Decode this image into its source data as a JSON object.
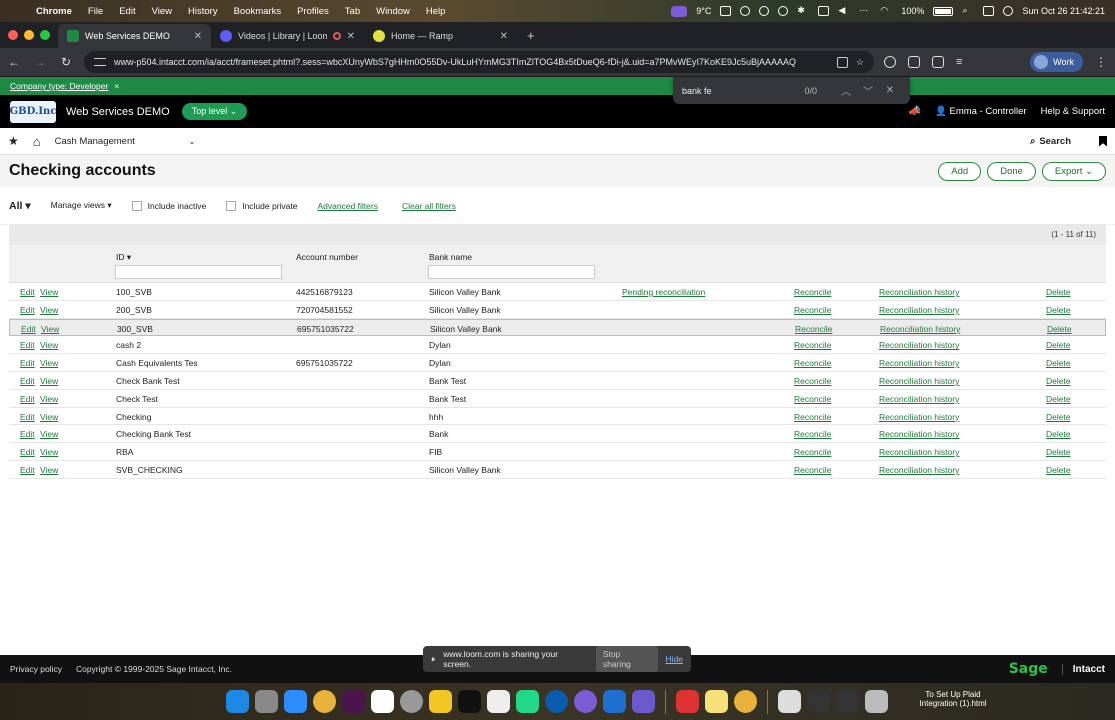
{
  "mac_menu": {
    "app": "Chrome",
    "items": [
      "File",
      "Edit",
      "View",
      "History",
      "Bookmarks",
      "Profiles",
      "Tab",
      "Window",
      "Help"
    ],
    "weather": "9°C",
    "battery": "100%",
    "datetime": "Sun Oct 26  21:42:21"
  },
  "tabs": [
    {
      "title": "Web Services DEMO",
      "active": true,
      "favicon_color": "#1f8a45"
    },
    {
      "title": "Videos | Library | Loom",
      "active": false,
      "favicon_color": "#625df5"
    },
    {
      "title": "Home — Ramp",
      "active": false,
      "favicon_color": "#e4e13a"
    }
  ],
  "address": {
    "url": "www-p504.intacct.com/ia/acct/frameset.phtml?.sess=wbcXUnyWbS7gHHm0O55Dv-UkLuHYmMG3TImZlTOG4Bx5tDueQ6-fDi-j&.uid=a7PMvWEyI7KoKE9Jc5uBjAAAAAQ",
    "profile": "Work"
  },
  "find_bar": {
    "query": "bank fe",
    "count": "0/0"
  },
  "banner": {
    "text": "Company type: Developer",
    "close": "×"
  },
  "header": {
    "logo": "GBD.Inc",
    "company": "Web Services DEMO",
    "level": "Top level",
    "user": "Emma - Controller",
    "help": "Help & Support"
  },
  "nav": {
    "module": "Cash Management",
    "search": "Search"
  },
  "page": {
    "title": "Checking accounts",
    "actions": [
      "Add",
      "Done",
      "Export"
    ]
  },
  "filters": {
    "view": "All",
    "manage_views": "Manage views",
    "include_inactive": "Include inactive",
    "include_private": "Include private",
    "advanced": "Advanced filters",
    "clear": "Clear all filters"
  },
  "table": {
    "pager": "(1 - 11 of 11)",
    "headers": {
      "id": "ID",
      "account": "Account number",
      "bank": "Bank name"
    },
    "row_actions": {
      "edit": "Edit",
      "view": "View",
      "reconcile": "Reconcile",
      "history": "Reconciliation history",
      "delete": "Delete"
    },
    "rows": [
      {
        "id": "100_SVB",
        "account": "442516879123",
        "bank": "Silicon Valley Bank",
        "status": "Pending reconciliation"
      },
      {
        "id": "200_SVB",
        "account": "720704581552",
        "bank": "Silicon Valley Bank",
        "status": ""
      },
      {
        "id": "300_SVB",
        "account": "695751035722",
        "bank": "Silicon Valley Bank",
        "status": ""
      },
      {
        "id": "cash 2",
        "account": "",
        "bank": "Dylan",
        "status": ""
      },
      {
        "id": "Cash Equivalents Tes",
        "account": "695751035722",
        "bank": "Dylan",
        "status": ""
      },
      {
        "id": "Check Bank Test",
        "account": "",
        "bank": "Bank Test",
        "status": ""
      },
      {
        "id": "Check Test",
        "account": "",
        "bank": "Bank Test",
        "status": ""
      },
      {
        "id": "Checking",
        "account": "",
        "bank": "hhh",
        "status": ""
      },
      {
        "id": "Checking Bank Test",
        "account": "",
        "bank": "Bank",
        "status": ""
      },
      {
        "id": "RBA",
        "account": "",
        "bank": "FIB",
        "status": ""
      },
      {
        "id": "SVB_CHECKING",
        "account": "",
        "bank": "Silicon Valley Bank",
        "status": ""
      }
    ]
  },
  "footer": {
    "privacy": "Privacy policy",
    "copyright": "Copyright © 1999-2025 Sage Intacct, Inc.",
    "sage": "Sage",
    "intacct": "Intacct"
  },
  "share_bar": {
    "text": "www.loom.com is sharing your screen.",
    "stop": "Stop sharing",
    "hide": "Hide"
  },
  "dock_file": "To Set Up Plaid Integration (1).html",
  "colors": {
    "accent": "#1f8a45",
    "link": "#1f7a3a",
    "header_bg": "#000000"
  }
}
